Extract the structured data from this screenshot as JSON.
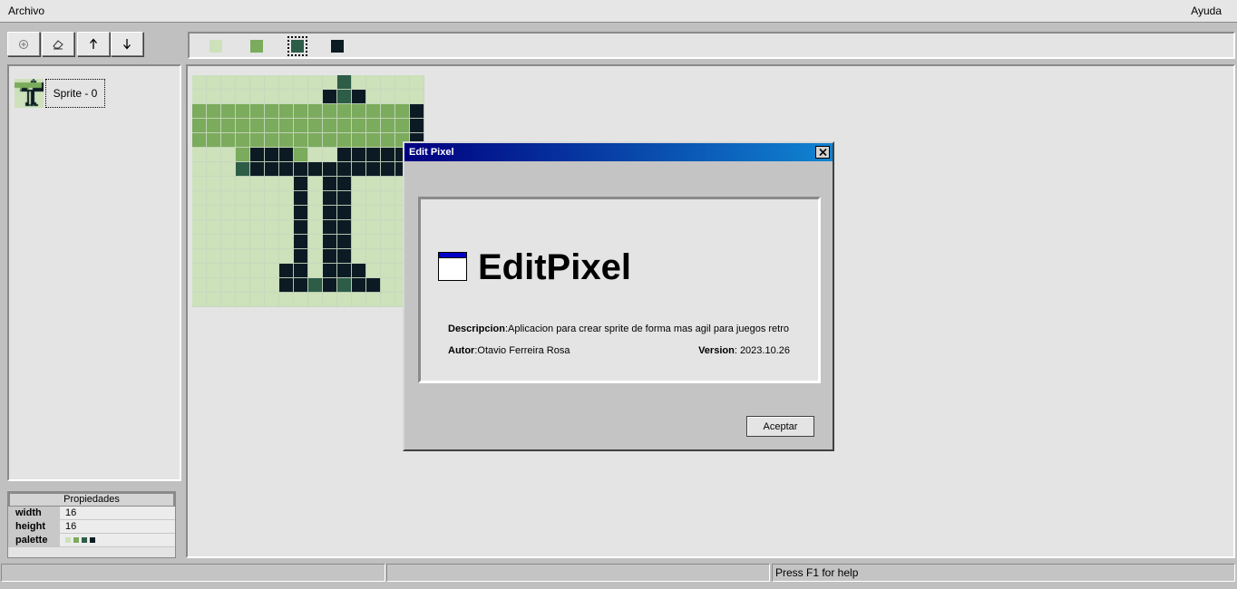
{
  "menubar": {
    "file": "Archivo",
    "help": "Ayuda"
  },
  "toolbar": {
    "buttons": [
      {
        "name": "add-sprite-button",
        "icon": "add-circle-icon"
      },
      {
        "name": "eraser-button",
        "icon": "eraser-icon"
      },
      {
        "name": "move-up-button",
        "icon": "arrow-up-icon"
      },
      {
        "name": "move-down-button",
        "icon": "arrow-down-icon"
      }
    ]
  },
  "palette": {
    "colors": [
      "#cde1bb",
      "#7bab5c",
      "#2d5c47",
      "#0c1b23"
    ],
    "selected_index": 2
  },
  "sprites": [
    {
      "label": "Sprite - 0"
    }
  ],
  "properties": {
    "header": "Propiedades",
    "rows": [
      {
        "key": "width",
        "value": "16"
      },
      {
        "key": "height",
        "value": "16"
      },
      {
        "key": "palette",
        "value": ""
      }
    ]
  },
  "sprite_pixels": [
    "0000000000200000",
    "0000000003230000",
    "1111111111111113",
    "1111111111111113",
    "1111111111111113",
    "0001333100333333",
    "0002333333333333",
    "0000000303300000",
    "0000000303300000",
    "0000000303300000",
    "0000000303300000",
    "0000000303300000",
    "0000000303300000",
    "0000003303330000",
    "0000003323233000",
    "0000000000000000"
  ],
  "dialog": {
    "title": "Edit Pixel",
    "app_name": "EditPixel",
    "desc_label": "Descripcion",
    "desc_value": ":Aplicacion para crear sprite de forma mas agil para juegos retro",
    "author_label": "Autor",
    "author_value": ":Otavio Ferreira Rosa",
    "version_label": "Version",
    "version_value": ": 2023.10.26",
    "ok_label": "Aceptar"
  },
  "statusbar": {
    "help_text": "Press F1 for help"
  }
}
